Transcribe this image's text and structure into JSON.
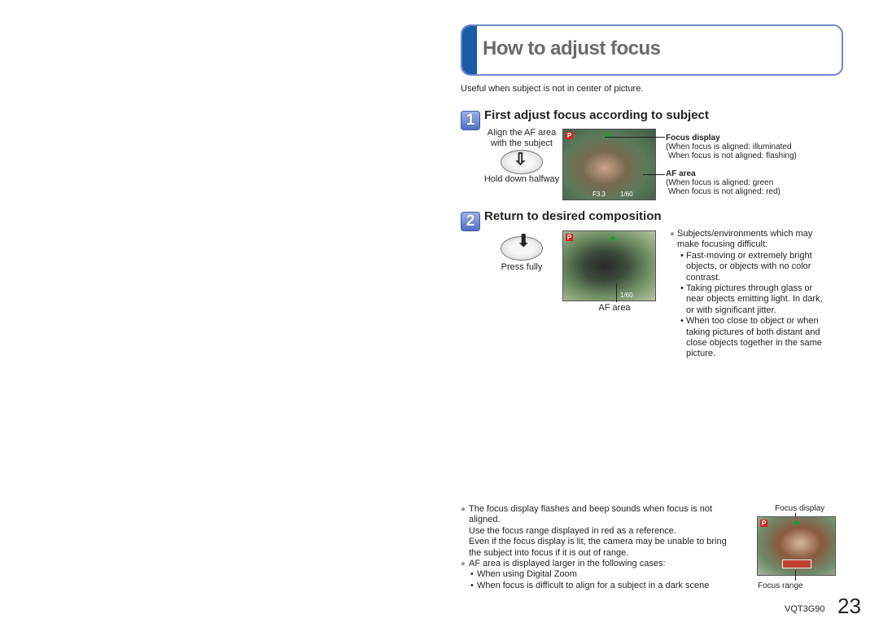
{
  "title": "How to adjust focus",
  "intro": "Useful when subject is not in center of picture.",
  "step1": {
    "number": "1",
    "heading": "First adjust focus according to subject",
    "caption_top": [
      "Align the AF area",
      "with the subject"
    ],
    "caption_bottom": "Hold down halfway",
    "camera": {
      "mode": "P",
      "aperture": "F3.3",
      "shutter": "1/60"
    },
    "focus_display": {
      "label": "Focus display",
      "lines": [
        "(When focus is aligned: illuminated",
        "When focus is not aligned: flashing)"
      ]
    },
    "af_area": {
      "label": "AF area",
      "lines": [
        "(When focus is aligned: green",
        "When focus is not aligned: red)"
      ]
    }
  },
  "step2": {
    "number": "2",
    "heading": "Return to desired composition",
    "caption": "Press fully",
    "camera": {
      "mode": "P",
      "shutter": "1/60"
    },
    "image_label": "AF area",
    "difficult": {
      "intro": [
        "Subjects/environments which may",
        "make focusing difficult:"
      ],
      "items": [
        [
          "Fast-moving or extremely bright",
          "objects, or objects with no color",
          "contrast."
        ],
        [
          "Taking pictures through glass or",
          "near objects emitting light. In dark,",
          "or with significant jitter."
        ],
        [
          "When too close to object or when",
          "taking pictures of both distant and",
          "close objects together in the same",
          "picture."
        ]
      ]
    }
  },
  "notes": {
    "note1": [
      "The focus display flashes and beep sounds when focus is not",
      "aligned.",
      "Use the focus range displayed in red as a reference.",
      "Even if the focus display is lit, the camera may be unable to bring",
      "the subject into focus if it is out of range."
    ],
    "note2": "AF area is displayed larger in the following cases:",
    "cases": [
      "When using Digital Zoom",
      "When focus is difficult to align for a subject in a dark scene"
    ],
    "image_top_label": "Focus display",
    "image_bottom_label": "Focus range",
    "camera_mode": "P"
  },
  "footer": {
    "code": "VQT3G90",
    "page": "23"
  },
  "colors": {
    "accent": "#1a5aa8",
    "border": "#6f87cc"
  }
}
